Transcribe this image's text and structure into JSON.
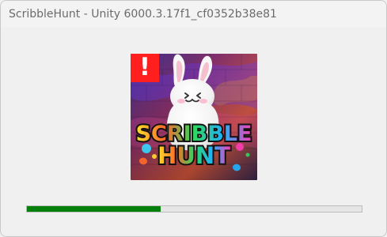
{
  "window": {
    "title": "ScribbleHunt - Unity 6000.3.17f1_cf0352b38e81"
  },
  "splash": {
    "logo_line1": "SCRIBBLE",
    "logo_line2": "HUNT",
    "badge_glyph": "!"
  },
  "progress": {
    "value_fraction": 0.4
  },
  "colors": {
    "progress_fill": "#06800c",
    "badge_red": "#ff1f1f"
  },
  "icons": {
    "badge": "warning-icon"
  }
}
